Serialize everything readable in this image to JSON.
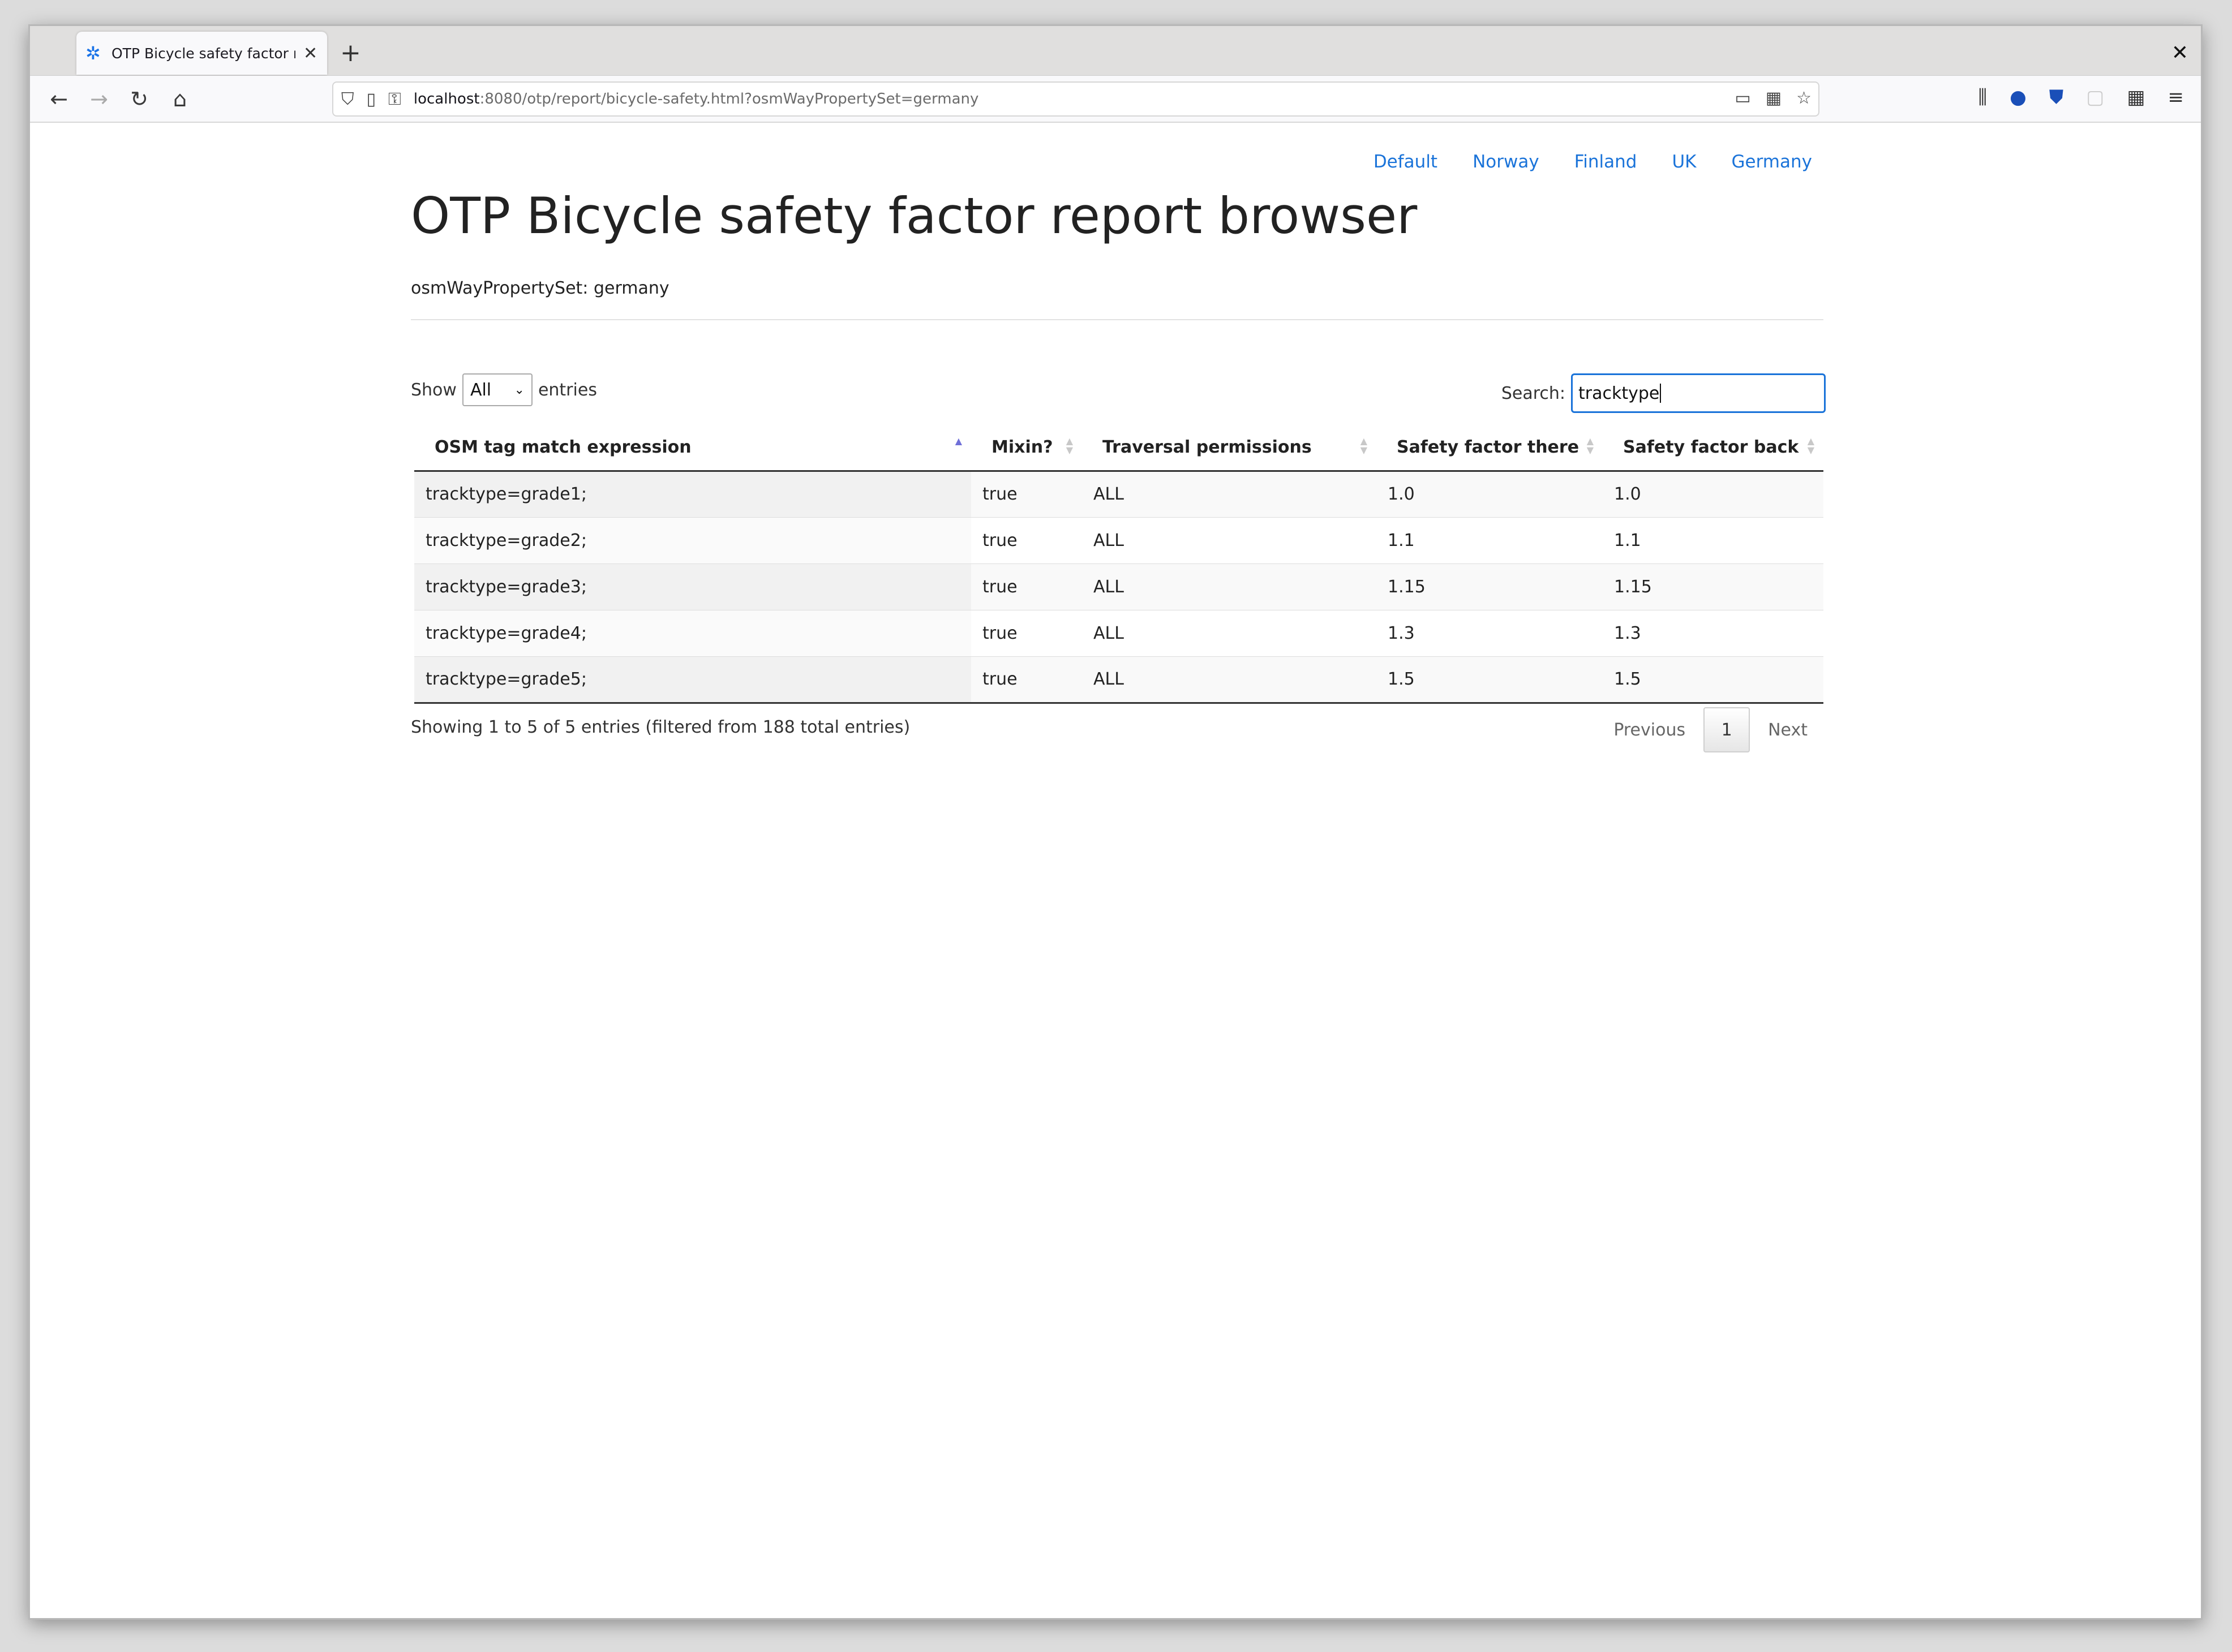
{
  "browser": {
    "tab_title": "OTP Bicycle safety factor re",
    "url_host": "localhost",
    "url_path": ":8080/otp/report/bicycle-safety.html?osmWayPropertySet=germany",
    "badge_count": "1"
  },
  "nav": {
    "links": [
      "Default",
      "Norway",
      "Finland",
      "UK",
      "Germany"
    ]
  },
  "header": {
    "title": "OTP Bicycle safety factor report browser",
    "subtitle": "osmWayPropertySet: germany"
  },
  "controls": {
    "show_label": "Show",
    "show_value": "All",
    "entries_label": "entries",
    "search_label": "Search:",
    "search_value": "tracktype"
  },
  "table": {
    "columns": [
      "OSM tag match expression",
      "Mixin?",
      "Traversal permissions",
      "Safety factor there",
      "Safety factor back"
    ],
    "rows": [
      [
        "tracktype=grade1;",
        "true",
        "ALL",
        "1.0",
        "1.0"
      ],
      [
        "tracktype=grade2;",
        "true",
        "ALL",
        "1.1",
        "1.1"
      ],
      [
        "tracktype=grade3;",
        "true",
        "ALL",
        "1.15",
        "1.15"
      ],
      [
        "tracktype=grade4;",
        "true",
        "ALL",
        "1.3",
        "1.3"
      ],
      [
        "tracktype=grade5;",
        "true",
        "ALL",
        "1.5",
        "1.5"
      ]
    ]
  },
  "footer": {
    "info": "Showing 1 to 5 of 5 entries (filtered from 188 total entries)",
    "previous": "Previous",
    "page": "1",
    "next": "Next"
  }
}
